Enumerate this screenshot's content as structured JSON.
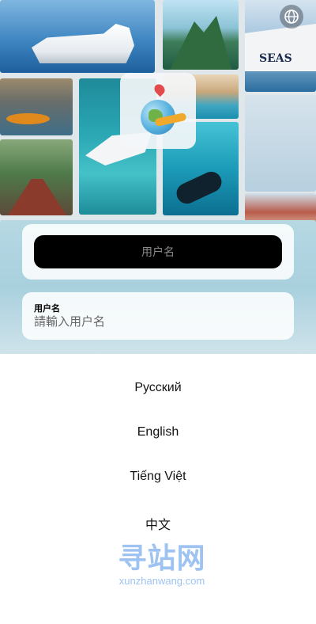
{
  "background": {
    "tiles": [
      "cruise-ship",
      "tropical-island",
      "cruise-ship-seas",
      "resort",
      "kayak",
      "speedboat",
      "bridge-hiker",
      "diver",
      "harbor",
      "venice",
      "sea"
    ],
    "ship_text": "SEAS"
  },
  "header": {
    "language_icon": "globe-icon"
  },
  "login": {
    "submit_label": "用户名",
    "username_label": "用户名",
    "username_placeholder": "請輸入用户名",
    "username_value": ""
  },
  "language_menu": {
    "options": [
      {
        "label": "Русский"
      },
      {
        "label": "English"
      },
      {
        "label": "Tiếng Việt"
      },
      {
        "label": "中文"
      }
    ]
  },
  "watermark": {
    "title": "寻站网",
    "subtitle": "xunzhanwang.com"
  },
  "colors": {
    "button_bg": "#000000",
    "watermark": "#9ec3f2",
    "sheet_bg": "#ffffff"
  }
}
